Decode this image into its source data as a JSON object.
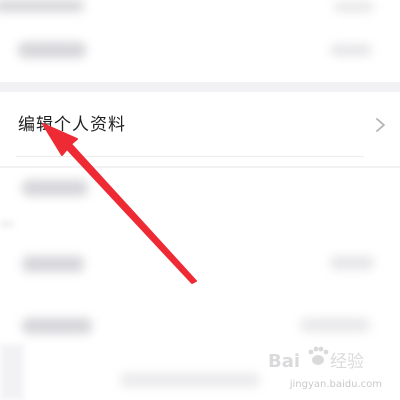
{
  "profile_row": {
    "label": "编辑个人资料"
  },
  "icons": {
    "chevron": "chevron-right-icon",
    "watermark": "baidu-paw-logo"
  },
  "watermark": {
    "url": "jingyan.baidu.com"
  },
  "colors": {
    "arrow": "#ee2a34",
    "background": "#f2f2f4",
    "card": "#ffffff",
    "label_text": "#222222",
    "chevron": "#b4b4b8"
  }
}
